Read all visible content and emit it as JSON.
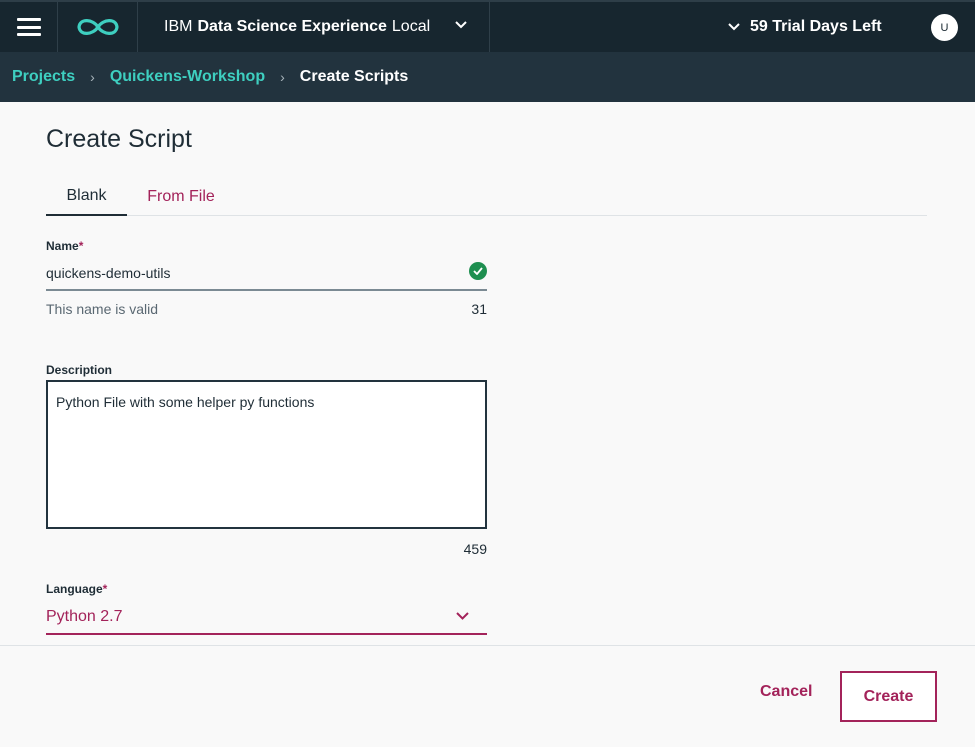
{
  "topbar": {
    "brand": "IBM",
    "product": "Data Science Experience",
    "edition": "Local",
    "trial": "59 Trial Days Left",
    "avatar_initial": "U"
  },
  "breadcrumb": {
    "projects": "Projects",
    "project": "Quickens-Workshop",
    "current": "Create Scripts"
  },
  "page": {
    "title": "Create Script"
  },
  "tabs": [
    {
      "label": "Blank",
      "active": true
    },
    {
      "label": "From File",
      "active": false
    }
  ],
  "form": {
    "name_label": "Name",
    "name_value": "quickens-demo-utils",
    "name_helper": "This name is valid",
    "name_count": "31",
    "description_label": "Description",
    "description_value": "Python File with some helper py functions",
    "description_count": "459",
    "language_label": "Language",
    "language_value": "Python 2.7",
    "required_mark": "*"
  },
  "actions": {
    "cancel": "Cancel",
    "create": "Create"
  },
  "colors": {
    "topbar": "#17262f",
    "breadcrumb_bar": "#22333e",
    "link_teal": "#3ecfc0",
    "accent_magenta": "#a3235a",
    "valid_green": "#1e8f50"
  }
}
